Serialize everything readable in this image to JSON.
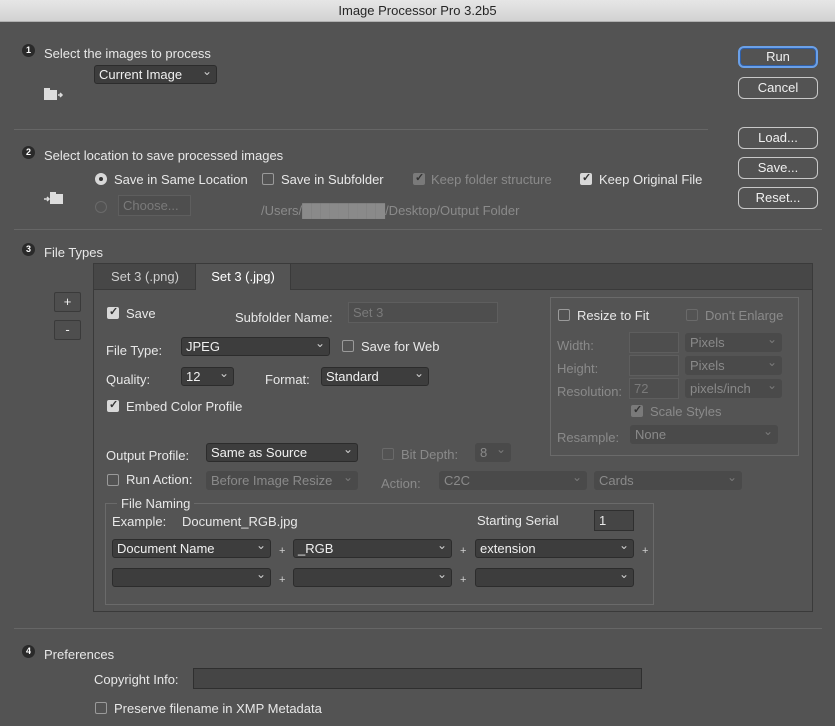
{
  "window": {
    "title": "Image Processor Pro 3.2b5"
  },
  "step1": {
    "num": "1",
    "title": "Select the images to process",
    "source": "Current Image"
  },
  "step2": {
    "num": "2",
    "title": "Select location to save processed images",
    "same_location": "Save in Same Location",
    "subfolder": "Save in Subfolder",
    "keep_structure": "Keep folder structure",
    "keep_original": "Keep Original File",
    "choose": "Choose...",
    "path": "/Users/█████████/Desktop/Output Folder"
  },
  "buttons": {
    "run": "Run",
    "cancel": "Cancel",
    "load": "Load...",
    "save": "Save...",
    "reset": "Reset..."
  },
  "step3": {
    "num": "3",
    "title": "File Types",
    "add": "+",
    "remove": "-",
    "tabs": [
      "Set 3 (.png)",
      "Set 3 (.jpg)"
    ],
    "save_label": "Save",
    "subfolder_name_label": "Subfolder Name:",
    "subfolder_name_placeholder": "Set 3",
    "file_type_label": "File Type:",
    "file_type": "JPEG",
    "save_for_web": "Save for Web",
    "quality_label": "Quality:",
    "quality": "12",
    "format_label": "Format:",
    "format": "Standard",
    "embed_profile": "Embed Color Profile",
    "output_profile_label": "Output Profile:",
    "output_profile": "Same as Source",
    "bit_depth_label": "Bit Depth:",
    "bit_depth": "8",
    "run_action_label": "Run Action:",
    "run_action_when": "Before Image Resize",
    "action_label": "Action:",
    "action_set": "C2C",
    "action_name": "Cards",
    "resize": {
      "resize_to_fit": "Resize to Fit",
      "dont_enlarge": "Don't Enlarge",
      "width_label": "Width:",
      "width_unit": "Pixels",
      "height_label": "Height:",
      "height_unit": "Pixels",
      "resolution_label": "Resolution:",
      "resolution_value": "72",
      "resolution_unit": "pixels/inch",
      "scale_styles": "Scale Styles",
      "resample_label": "Resample:",
      "resample": "None"
    },
    "naming": {
      "title": "File Naming",
      "example_label": "Example:",
      "example": "Document_RGB.jpg",
      "starting_serial_label": "Starting Serial",
      "starting_serial": "1",
      "row1": [
        "Document Name",
        "_RGB",
        "extension"
      ],
      "row2": [
        "",
        "",
        ""
      ],
      "plus": "+"
    }
  },
  "step4": {
    "num": "4",
    "title": "Preferences",
    "copyright_label": "Copyright Info:",
    "copyright_value": "",
    "preserve_filename": "Preserve filename in XMP Metadata"
  }
}
